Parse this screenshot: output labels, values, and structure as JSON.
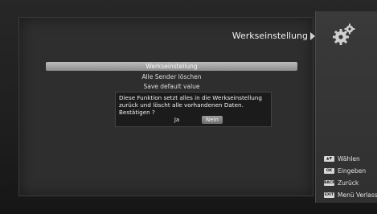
{
  "header": {
    "title": "Werkseinstellung"
  },
  "menu": {
    "items": [
      {
        "label": "Werkseinstellung"
      },
      {
        "label": "Alle Sender löschen"
      },
      {
        "label": "Save default value"
      }
    ]
  },
  "dialog": {
    "message": "Diese Funktion setzt alles in die Werkseinstellung zurück und löscht alle vorhandenen Daten. Bestätigen ?",
    "yes_label": "Ja",
    "no_label": "Nein"
  },
  "legend": {
    "items": [
      {
        "key": "▲▼",
        "label": "Wählen"
      },
      {
        "key": "OK",
        "label": "Eingeben"
      },
      {
        "key": "BACK",
        "label": "Zurück"
      },
      {
        "key": "EXIT",
        "label": "Menü Verlassen"
      }
    ]
  },
  "colors": {
    "accent": "#9a9a9a",
    "background": "#2e2e2e"
  }
}
